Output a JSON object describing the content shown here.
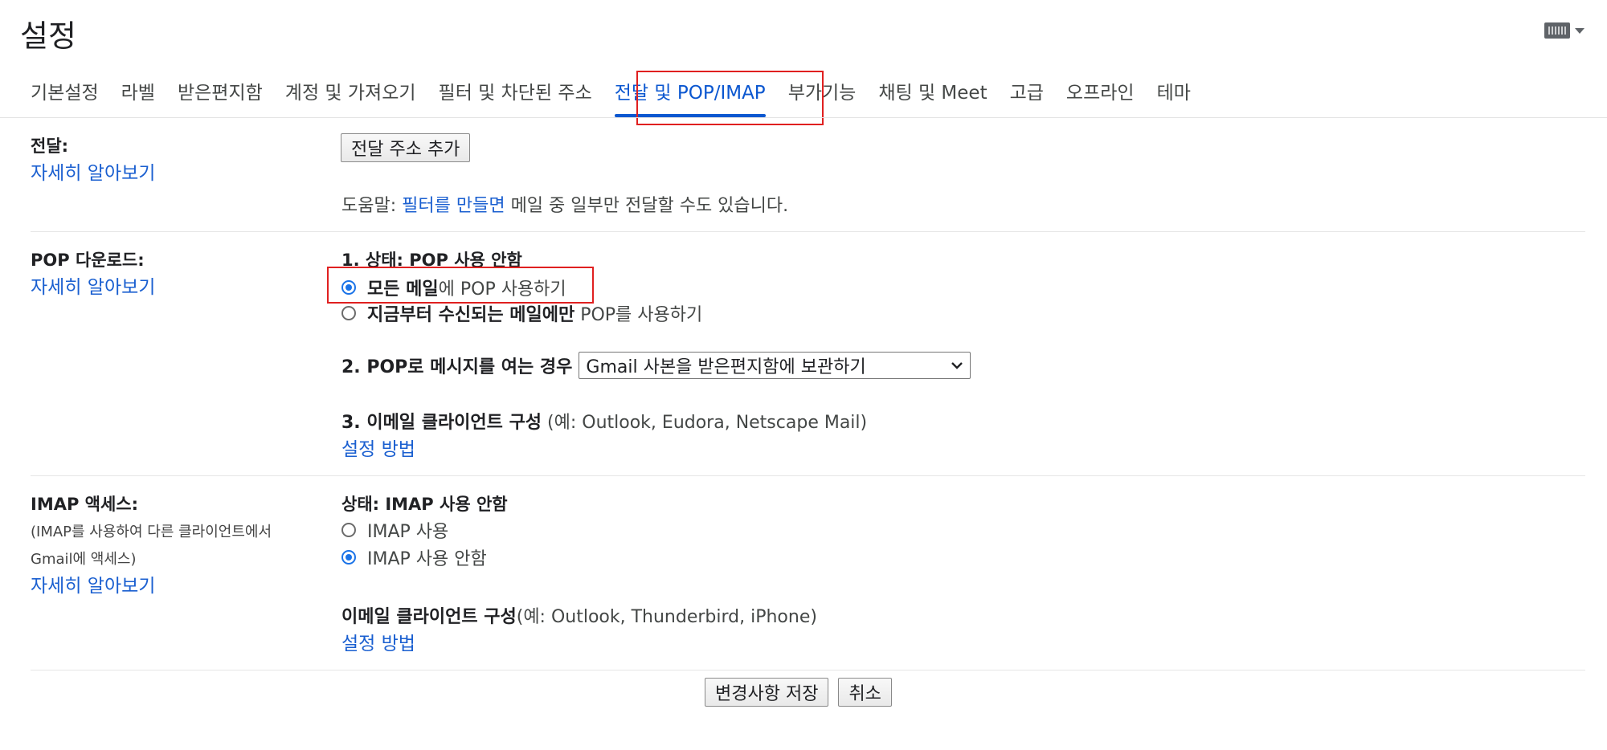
{
  "page": {
    "title": "설정"
  },
  "tabs": [
    "기본설정",
    "라벨",
    "받은편지함",
    "계정 및 가져오기",
    "필터 및 차단된 주소",
    "전달 및 POP/IMAP",
    "부가기능",
    "채팅 및 Meet",
    "고급",
    "오프라인",
    "테마"
  ],
  "active_tab_index": 5,
  "forwarding": {
    "label": "전달:",
    "learn_more": "자세히 알아보기",
    "add_button": "전달 주소 추가",
    "help_prefix": "도움말: ",
    "help_link": "필터를 만들면",
    "help_suffix": " 메일 중 일부만 전달할 수도 있습니다."
  },
  "pop": {
    "label": "POP 다운로드:",
    "learn_more": "자세히 알아보기",
    "status": "1. 상태: POP 사용 안함",
    "option_all_bold": "모든 메일",
    "option_all_rest": "에 POP 사용하기",
    "option_new_bold": "지금부터 수신되는 메일에만",
    "option_new_rest": " POP를 사용하기",
    "selected_option": "all",
    "when_accessed_label": "2. POP로 메시지를 여는 경우",
    "when_accessed_value": "Gmail 사본을 받은편지함에 보관하기",
    "client_config_bold": "3. 이메일 클라이언트 구성",
    "client_config_rest": " (예: Outlook, Eudora, Netscape Mail)",
    "setup_link": "설정 방법"
  },
  "imap": {
    "label": "IMAP 액세스:",
    "desc_line1": "(IMAP를 사용하여 다른 클라이언트에서",
    "desc_line2": "Gmail에 액세스)",
    "learn_more": "자세히 알아보기",
    "status": "상태: IMAP 사용 안함",
    "option_enable": "IMAP 사용",
    "option_disable": "IMAP 사용 안함",
    "selected_option": "disable",
    "client_config_bold": "이메일 클라이언트 구성",
    "client_config_rest": "(예: Outlook, Thunderbird, iPhone)",
    "setup_link": "설정 방법"
  },
  "footer": {
    "save": "변경사항 저장",
    "cancel": "취소"
  }
}
